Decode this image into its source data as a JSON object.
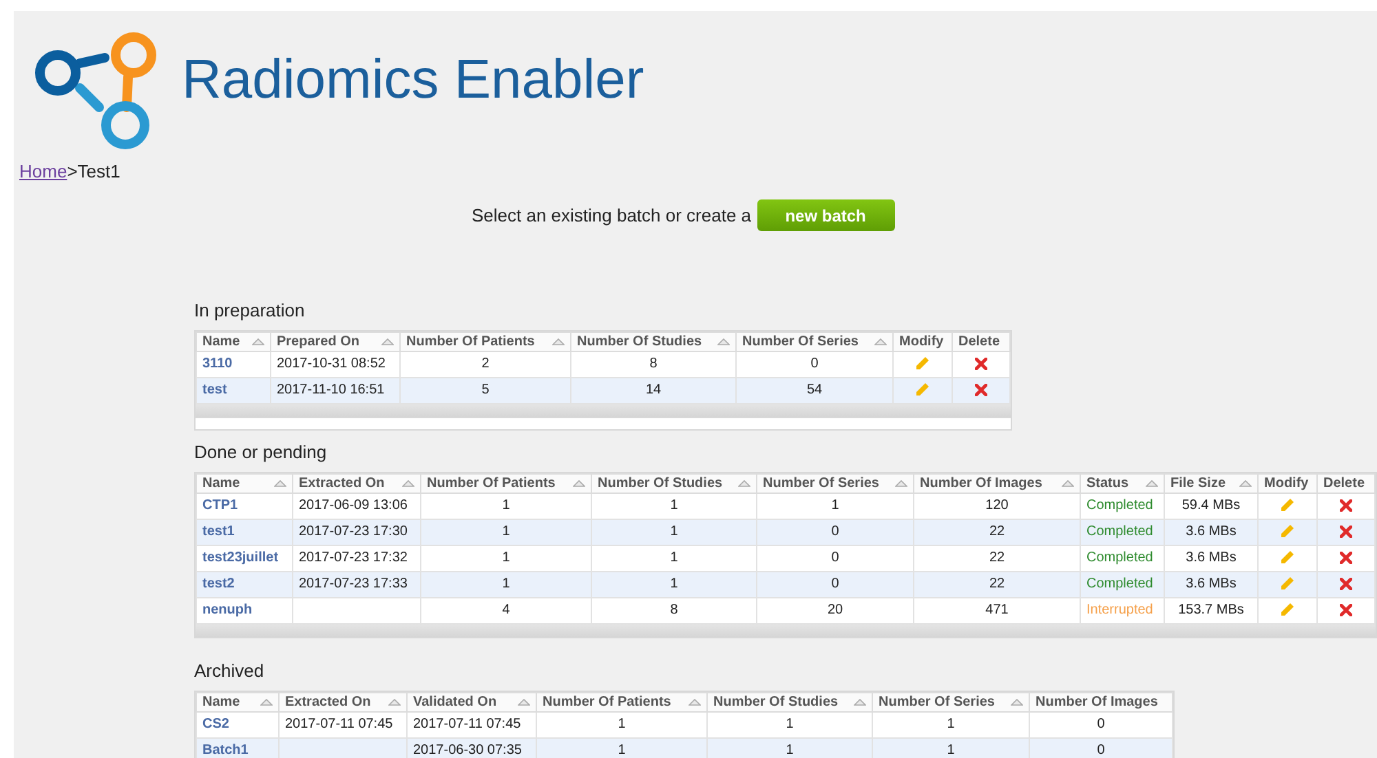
{
  "header": {
    "title": "Radiomics Enabler"
  },
  "breadcrumb": {
    "home": "Home",
    "separator": ">",
    "current": "Test1"
  },
  "prompt": {
    "text": "Select an existing batch or create a",
    "button": "new batch"
  },
  "sections": [
    {
      "title": "In preparation",
      "scrollbar": true,
      "footer": true,
      "columns": [
        {
          "label": "Name",
          "sortable": true,
          "kind": "name"
        },
        {
          "label": "Prepared On",
          "sortable": true,
          "kind": "date"
        },
        {
          "label": "Number Of Patients",
          "sortable": true,
          "kind": "number"
        },
        {
          "label": "Number Of Studies",
          "sortable": true,
          "kind": "number"
        },
        {
          "label": "Number Of Series",
          "sortable": true,
          "kind": "number"
        },
        {
          "label": "Modify",
          "sortable": false,
          "kind": "modify"
        },
        {
          "label": "Delete",
          "sortable": false,
          "kind": "delete"
        }
      ],
      "rows": [
        {
          "cells": [
            "3110",
            "2017-10-31 08:52",
            "2",
            "8",
            "0"
          ]
        },
        {
          "cells": [
            "test",
            "2017-11-10 16:51",
            "5",
            "14",
            "54"
          ]
        }
      ]
    },
    {
      "title": "Done or pending",
      "scrollbar": true,
      "footer": false,
      "columns": [
        {
          "label": "Name",
          "sortable": true,
          "kind": "name"
        },
        {
          "label": "Extracted On",
          "sortable": true,
          "kind": "date"
        },
        {
          "label": "Number Of Patients",
          "sortable": true,
          "kind": "number"
        },
        {
          "label": "Number Of Studies",
          "sortable": true,
          "kind": "number"
        },
        {
          "label": "Number Of Series",
          "sortable": true,
          "kind": "number"
        },
        {
          "label": "Number Of Images",
          "sortable": true,
          "kind": "number"
        },
        {
          "label": "Status",
          "sortable": true,
          "kind": "status"
        },
        {
          "label": "File Size",
          "sortable": true,
          "kind": "number"
        },
        {
          "label": "Modify",
          "sortable": false,
          "kind": "modify"
        },
        {
          "label": "Delete",
          "sortable": false,
          "kind": "delete"
        }
      ],
      "rows": [
        {
          "cells": [
            "CTP1",
            "2017-06-09 13:06",
            "1",
            "1",
            "1",
            "120",
            {
              "text": "Completed",
              "color": "#2e8b2e"
            },
            "59.4 MBs"
          ]
        },
        {
          "cells": [
            "test1",
            "2017-07-23 17:30",
            "1",
            "1",
            "0",
            "22",
            {
              "text": "Completed",
              "color": "#2e8b2e"
            },
            "3.6 MBs"
          ]
        },
        {
          "cells": [
            "test23juillet",
            "2017-07-23 17:32",
            "1",
            "1",
            "0",
            "22",
            {
              "text": "Completed",
              "color": "#2e8b2e"
            },
            "3.6 MBs"
          ]
        },
        {
          "cells": [
            "test2",
            "2017-07-23 17:33",
            "1",
            "1",
            "0",
            "22",
            {
              "text": "Completed",
              "color": "#2e8b2e"
            },
            "3.6 MBs"
          ]
        },
        {
          "cells": [
            "nenuph",
            "",
            "4",
            "8",
            "20",
            "471",
            {
              "text": "Interrupted",
              "color": "#f5a04a"
            },
            "153.7 MBs"
          ]
        }
      ]
    },
    {
      "title": "Archived",
      "scrollbar": false,
      "footer": false,
      "columns": [
        {
          "label": "Name",
          "sortable": true,
          "kind": "name"
        },
        {
          "label": "Extracted On",
          "sortable": true,
          "kind": "date"
        },
        {
          "label": "Validated On",
          "sortable": true,
          "kind": "date"
        },
        {
          "label": "Number Of Patients",
          "sortable": true,
          "kind": "number"
        },
        {
          "label": "Number Of Studies",
          "sortable": true,
          "kind": "number"
        },
        {
          "label": "Number Of Series",
          "sortable": true,
          "kind": "number"
        },
        {
          "label": "Number Of Images",
          "sortable": false,
          "kind": "number"
        }
      ],
      "rows": [
        {
          "cells": [
            "CS2",
            "2017-07-11 07:45",
            "2017-07-11 07:45",
            "1",
            "1",
            "1",
            "0"
          ]
        },
        {
          "cells": [
            "Batch1",
            "",
            "2017-06-30 07:35",
            "1",
            "1",
            "1",
            "0"
          ]
        }
      ]
    }
  ]
}
